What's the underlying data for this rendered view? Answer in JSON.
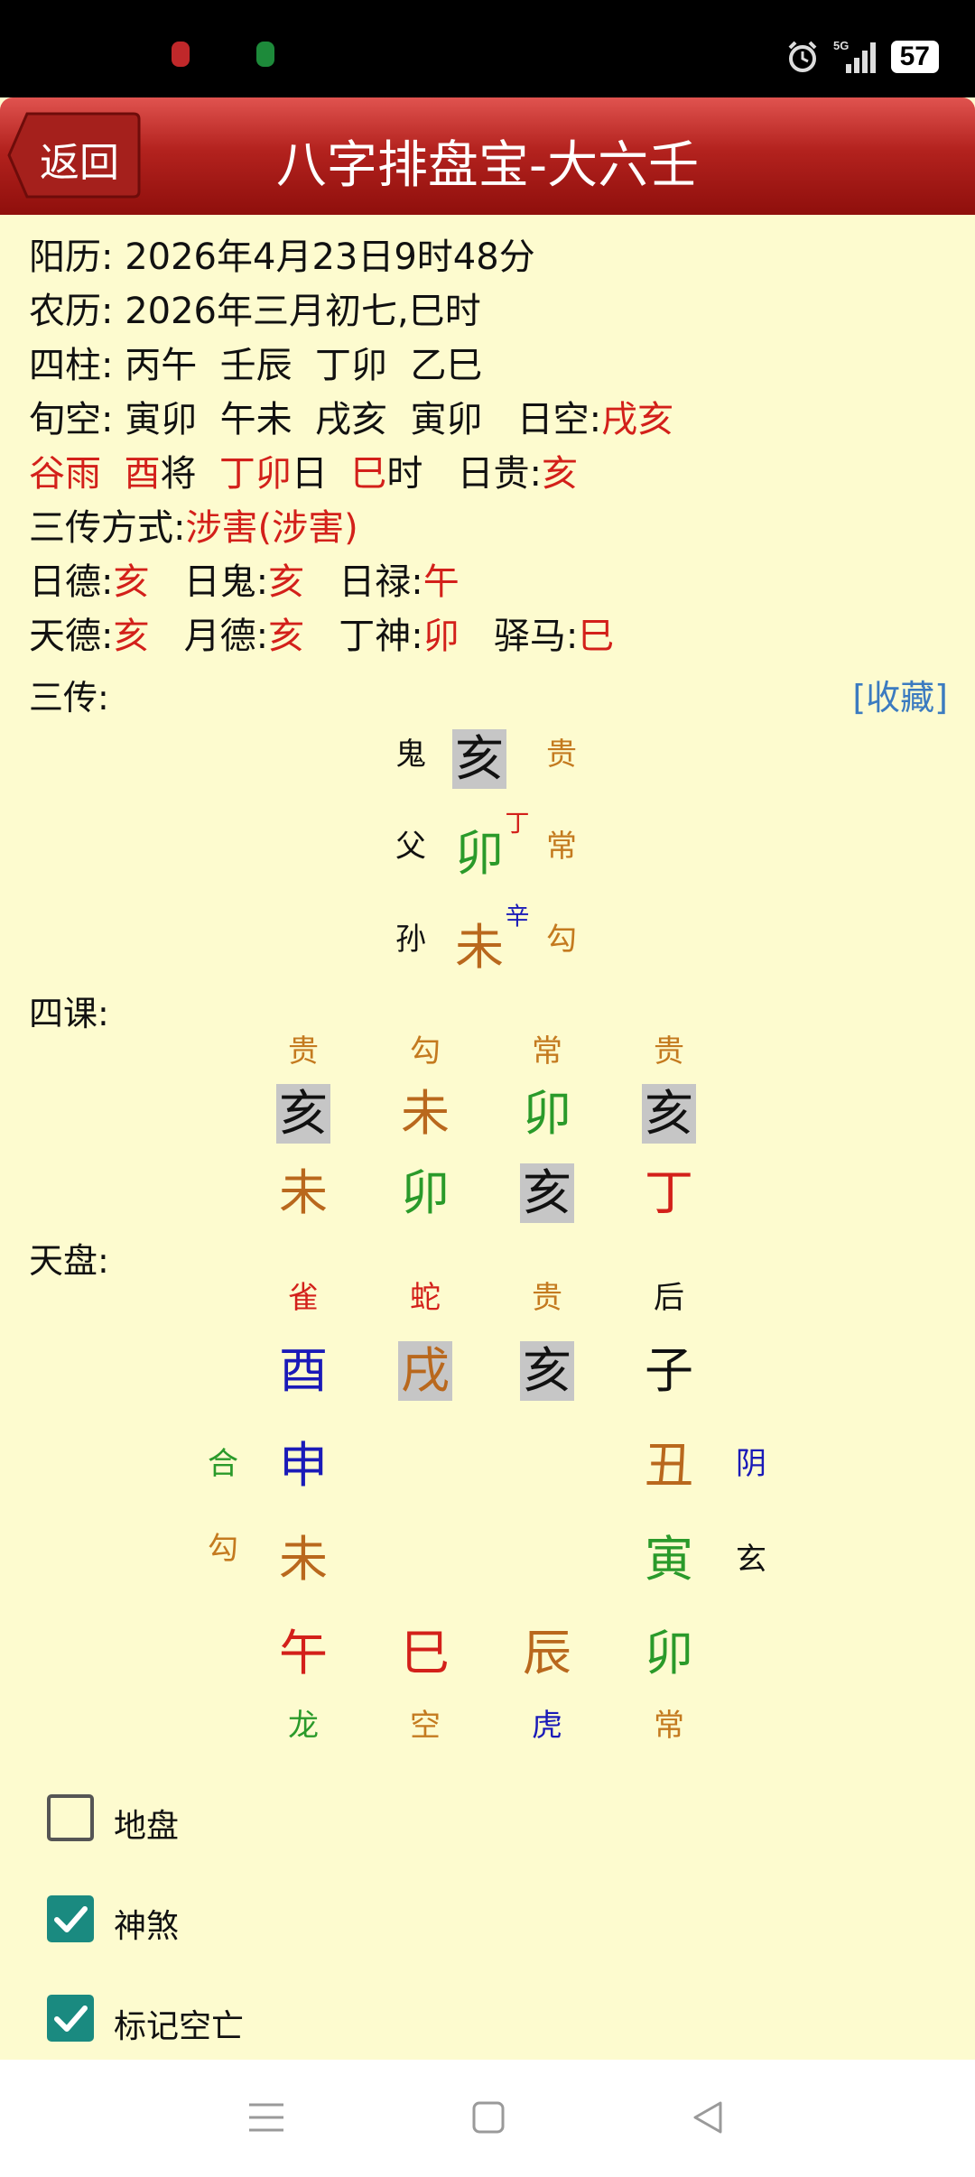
{
  "status_bar": {
    "battery": "57"
  },
  "header": {
    "back_label": "返回",
    "title": "八字排盘宝-大六壬"
  },
  "info": {
    "solar_label": "阳历:",
    "solar_value": " 2026年4月23日9时48分",
    "lunar_label": "农历:",
    "lunar_value": " 2026年三月初七,巳时",
    "pillars_label": "四柱:",
    "pillars_value": " 丙午  壬辰  丁卯  乙巳",
    "xunkong_label": "旬空:",
    "xunkong_value": " 寅卯  午未  戌亥  寅卯   日空:",
    "rikong_value": "戌亥",
    "jieqi": "谷雨",
    "yuejiang": "酉",
    "jiang_label": "将",
    "riganzhi": "丁卯",
    "ri_label": "日",
    "shi": "巳",
    "shi_label": "时",
    "rigui_label": "   日贵:",
    "rigui": "亥",
    "sanchuan_label": "三传方式:",
    "sanchuan_value": "涉害(涉害)",
    "ride_label": "日德:",
    "ride": "亥",
    "rigui2_label": "日鬼:",
    "rigui2": "亥",
    "rilu_label": "日禄:",
    "rilu": "午",
    "tiande_label": "天德:",
    "tiande": "亥",
    "yuede_label": "月德:",
    "yuede": "亥",
    "dingshen_label": "丁神:",
    "dingshen": "卯",
    "yima_label": "驿马:",
    "yima": "巳"
  },
  "sanchuan": {
    "label": "三传:",
    "favorite": "[收藏]",
    "rows": [
      {
        "relation": "鬼",
        "branch": "亥",
        "god": "贵",
        "sup": ""
      },
      {
        "relation": "父",
        "branch": "卯",
        "god": "常",
        "sup": "丁"
      },
      {
        "relation": "孙",
        "branch": "未",
        "god": "勾",
        "sup": "辛"
      }
    ]
  },
  "sike": {
    "label": "四课:",
    "gods": [
      "贵",
      "勾",
      "常",
      "贵"
    ],
    "upper": [
      "亥",
      "未",
      "卯",
      "亥"
    ],
    "lower": [
      "未",
      "卯",
      "亥",
      "丁"
    ]
  },
  "tianpan": {
    "label": "天盘:",
    "top_gods": [
      "雀",
      "蛇",
      "贵",
      "后"
    ],
    "top_branches": [
      "酉",
      "戌",
      "亥",
      "子"
    ],
    "left_gods": [
      "合",
      "勾"
    ],
    "left_branches": [
      "申",
      "未"
    ],
    "right_branches": [
      "丑",
      "寅"
    ],
    "right_gods": [
      "阴",
      "玄"
    ],
    "bottom_branches": [
      "午",
      "巳",
      "辰",
      "卯"
    ],
    "bottom_gods": [
      "龙",
      "空",
      "虎",
      "常"
    ]
  },
  "options": [
    {
      "label": "地盘",
      "checked": false
    },
    {
      "label": "神煞",
      "checked": true
    },
    {
      "label": "标记空亡",
      "checked": true
    }
  ],
  "colors": {
    "background": "#fdfbcf",
    "header_red": "#b3221e",
    "accent_red": "#d3201a",
    "checkbox_teal": "#1a8a80",
    "link_blue": "#3b7bc0"
  }
}
